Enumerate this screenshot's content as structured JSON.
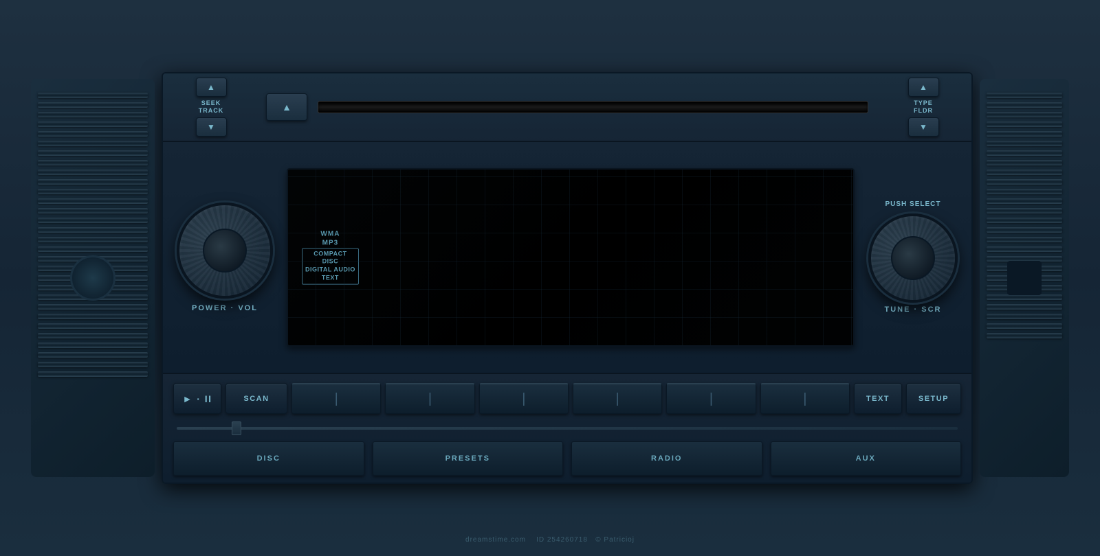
{
  "scene": {
    "background": "#1a2a35"
  },
  "top_controls": {
    "seek_up_label": "▲",
    "seek_down_label": "▼",
    "seek_track_label": "SEEK\nTRACK",
    "eject_label": "▲",
    "type_up_label": "▲",
    "type_down_label": "▼",
    "type_fldr_label": "TYPE\nFLDR"
  },
  "knobs": {
    "left_label": "POWER · VOL",
    "right_label": "TUNE · SCR",
    "push_select_label": "PUSH SELECT",
    "wma_label": "WMA",
    "mp3_label": "MP3",
    "disc_label": "COMPACT\nDISC\nDIGITAL AUDIO\nTEXT"
  },
  "buttons": {
    "play_pause_label": "► · II",
    "scan_label": "SCAN",
    "text_label": "TEXT",
    "setup_label": "SETUP",
    "disc_label": "DISC",
    "presets_label": "PRESETS",
    "radio_label": "RADIO",
    "aux_label": "AUX",
    "preset_count": 6
  },
  "watermark": {
    "site": "dreamstime.com",
    "id": "ID 254260718",
    "author": "© Patricioj"
  }
}
